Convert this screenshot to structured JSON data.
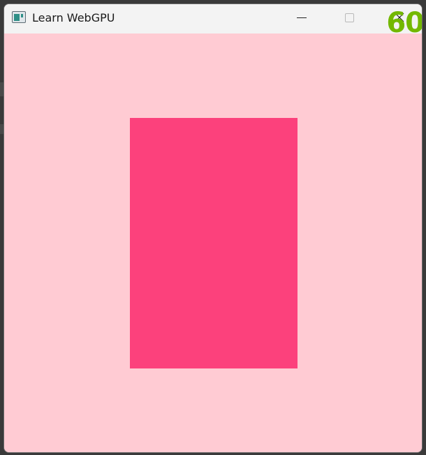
{
  "window": {
    "title": "Learn WebGPU",
    "app_icon": "window-app-icon"
  },
  "controls": {
    "minimize": "minimize-icon",
    "maximize": "maximize-icon",
    "close": "close-icon"
  },
  "overlay": {
    "fps": "60",
    "fps_color": "#73b800"
  },
  "scene": {
    "clear_color": "#ffcbd3",
    "quad_color": "#fc417c"
  }
}
